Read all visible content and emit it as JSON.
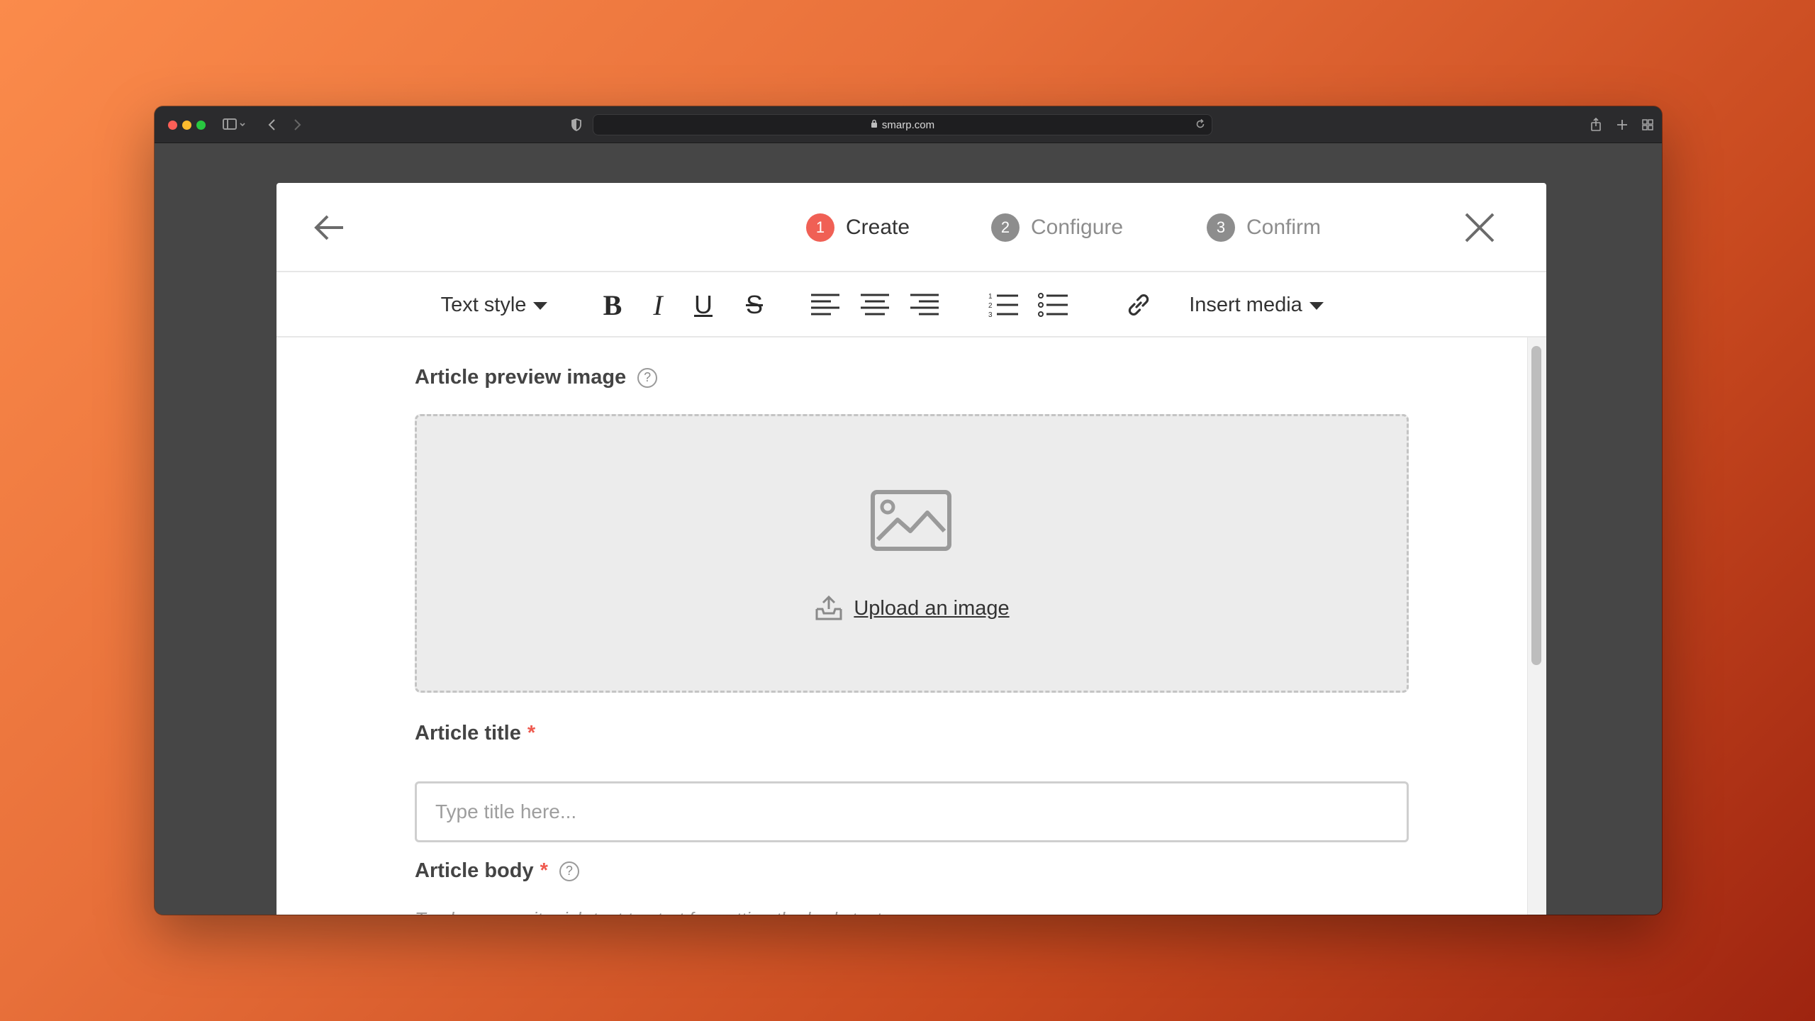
{
  "browser": {
    "url": "smarp.com",
    "icons": {
      "sidebar": "sidebar-icon",
      "back": "chevron-left-icon",
      "forward": "chevron-right-icon",
      "shield": "shield-icon",
      "reload": "reload-icon",
      "share": "share-icon",
      "new_tab": "plus-icon",
      "tabs": "tab-overview-icon"
    }
  },
  "wizard": {
    "steps": [
      {
        "number": "1",
        "label": "Create",
        "active": true
      },
      {
        "number": "2",
        "label": "Configure",
        "active": false
      },
      {
        "number": "3",
        "label": "Confirm",
        "active": false
      }
    ]
  },
  "toolbar": {
    "text_style_label": "Text style",
    "bold_label": "B",
    "italic_label": "I",
    "underline_label": "U",
    "strike_label": "S",
    "insert_media_label": "Insert media"
  },
  "form": {
    "preview_image_label": "Article preview image",
    "help_symbol": "?",
    "upload_label": "Upload an image",
    "title_label": "Article title",
    "required_mark": "*",
    "title_placeholder": "Type title here...",
    "title_value": "",
    "body_label": "Article body",
    "body_hint": "Tap here or write rich text to start formatting the body text"
  },
  "colors": {
    "accent": "#f06055",
    "inactive_step": "#8d8d8d",
    "text": "#333333",
    "dropzone_bg": "#ececec"
  }
}
